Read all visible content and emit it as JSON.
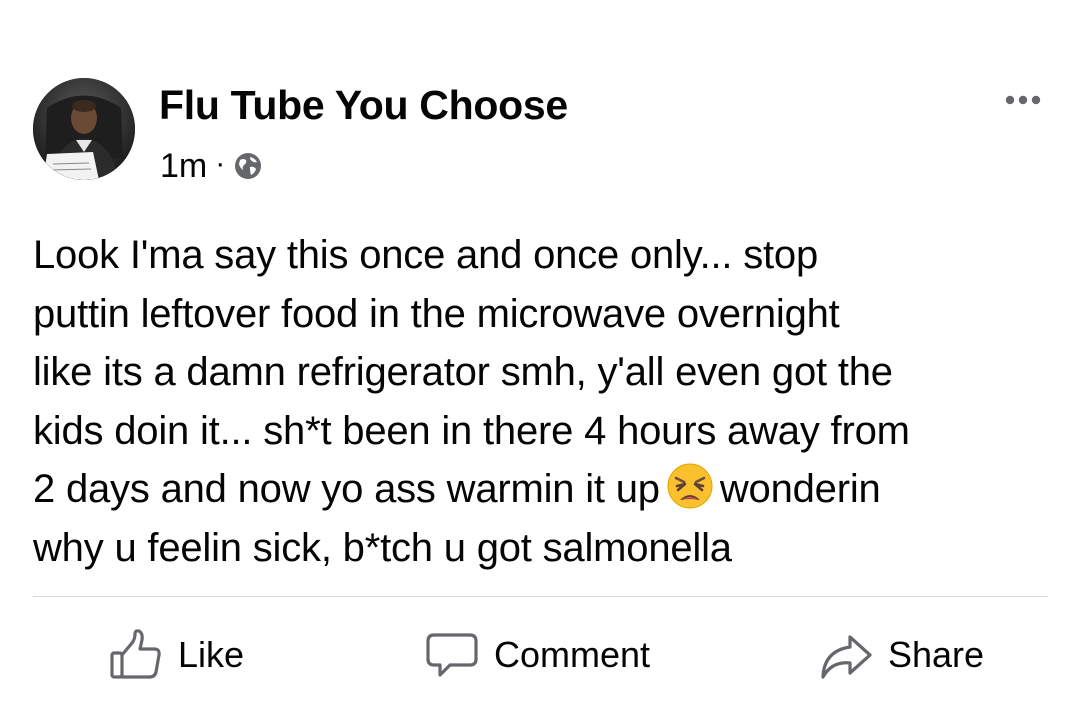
{
  "post": {
    "author_name": "Flu Tube You Choose",
    "timestamp": "1m",
    "separator": "·",
    "audience_icon": "globe-icon",
    "more_icon": "more-options-icon",
    "text_part1": "Look I'ma say this once and once only... stop\nputtin leftover food in the microwave overnight\nlike its a damn refrigerator smh, y'all even got the\nkids doin it... sh*t been in there 4 hours away from\n2 days and now yo ass warmin it up",
    "emoji": "weary-face-emoji",
    "text_part2": "wonderin\nwhy u feelin sick, b*tch u got salmonella"
  },
  "actions": {
    "like_label": "Like",
    "comment_label": "Comment",
    "share_label": "Share"
  },
  "colors": {
    "text": "#050505",
    "divider": "#d8d8d8",
    "emoji_face": "#fbc02d"
  }
}
